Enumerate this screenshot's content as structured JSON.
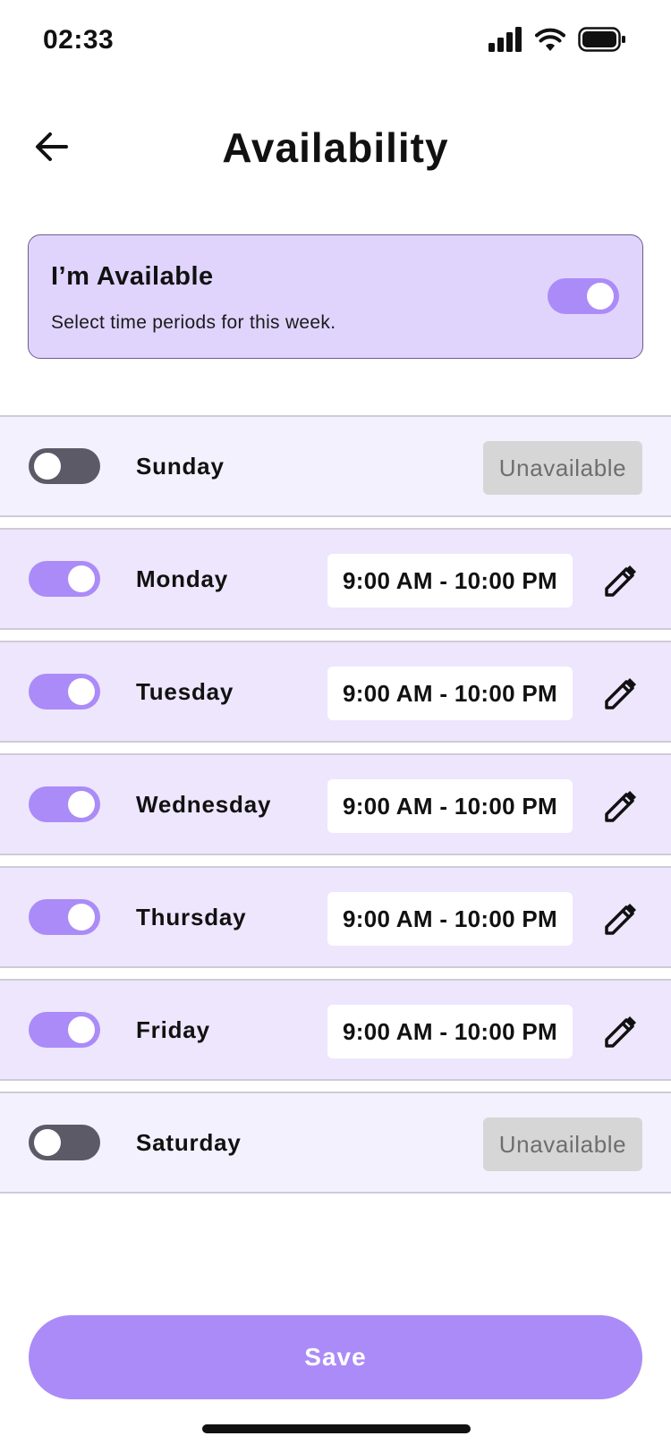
{
  "status_bar": {
    "time": "02:33",
    "icons": [
      "cellular-signal-icon",
      "wifi-icon",
      "battery-icon"
    ]
  },
  "header": {
    "title": "Availability",
    "back_icon": "arrow-left-icon"
  },
  "availability_card": {
    "title": "I’m Available",
    "subtitle": "Select time periods for this week.",
    "enabled": true
  },
  "days": [
    {
      "name": "Sunday",
      "enabled": false,
      "status": "Unavailable"
    },
    {
      "name": "Monday",
      "enabled": true,
      "time_range": "9:00 AM - 10:00 PM"
    },
    {
      "name": "Tuesday",
      "enabled": true,
      "time_range": "9:00 AM - 10:00 PM"
    },
    {
      "name": "Wednesday",
      "enabled": true,
      "time_range": "9:00 AM - 10:00 PM"
    },
    {
      "name": "Thursday",
      "enabled": true,
      "time_range": "9:00 AM - 10:00 PM"
    },
    {
      "name": "Friday",
      "enabled": true,
      "time_range": "9:00 AM - 10:00 PM"
    },
    {
      "name": "Saturday",
      "enabled": false,
      "status": "Unavailable"
    }
  ],
  "save_label": "Save",
  "colors": {
    "accent": "#ab8bf7",
    "card_background": "#e0d4fd",
    "row_enabled": "#ede6fd",
    "row_disabled": "#f4f1fe",
    "toggle_off": "#5c5a66",
    "unavailable_badge": "#d6d6d6"
  }
}
